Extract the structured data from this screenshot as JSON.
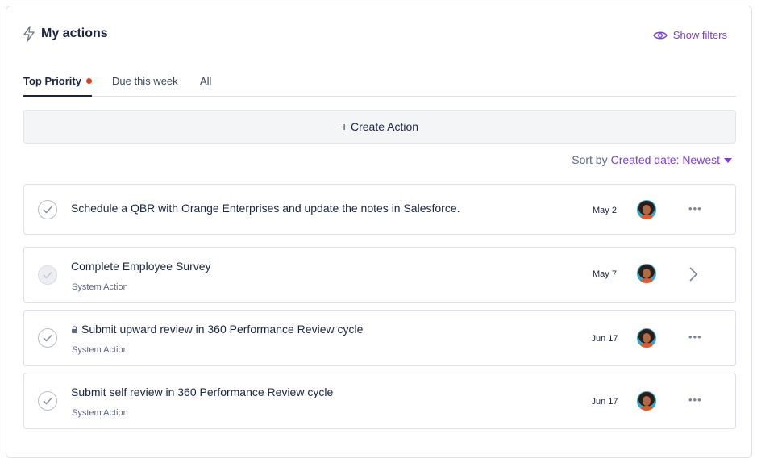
{
  "header": {
    "title": "My actions",
    "show_filters_label": "Show filters"
  },
  "tabs": [
    {
      "label": "Top Priority",
      "active": true,
      "has_dot": true
    },
    {
      "label": "Due this week",
      "active": false
    },
    {
      "label": "All",
      "active": false
    }
  ],
  "create_action_label": "+ Create Action",
  "sort": {
    "prefix": "Sort by",
    "value": "Created date: Newest"
  },
  "actions": [
    {
      "title": "Schedule a QBR with Orange Enterprises and update the notes in Salesforce.",
      "subtitle": "",
      "date": "May 2",
      "menu": "•••",
      "locked": false
    },
    {
      "title": "Complete Employee Survey",
      "subtitle": "System Action",
      "date": "May 7",
      "menu": "chevron-right",
      "locked": false
    },
    {
      "title": "Submit upward review in 360 Performance Review cycle",
      "subtitle": "System Action",
      "date": "Jun 17",
      "menu": "•••",
      "locked": true
    },
    {
      "title": "Submit self review in 360 Performance Review cycle",
      "subtitle": "System Action",
      "date": "Jun 17",
      "menu": "•••",
      "locked": false
    }
  ],
  "colors": {
    "accent": "#7b3fd6",
    "dot": "#e0431a",
    "text": "#1b2440",
    "border": "#dcdfe5"
  }
}
